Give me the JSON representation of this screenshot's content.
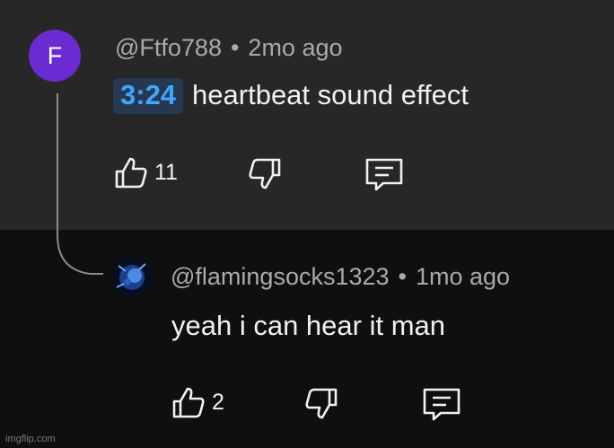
{
  "comment": {
    "avatar_letter": "F",
    "avatar_color": "#6a2bd0",
    "author": "@Ftfo788",
    "separator": "•",
    "age": "2mo ago",
    "timestamp_link": "3:24",
    "text": "heartbeat sound effect",
    "likes": "11",
    "icons": [
      "thumbs-up-icon",
      "thumbs-down-icon",
      "reply-icon"
    ]
  },
  "reply": {
    "author": "@flamingsocks1323",
    "separator": "•",
    "age": "1mo ago",
    "text": "yeah i can hear it man",
    "likes": "2",
    "icons": [
      "thumbs-up-icon",
      "thumbs-down-icon",
      "reply-icon"
    ]
  },
  "colors": {
    "top_bg": "#272727",
    "bottom_bg": "#0f0f0f",
    "meta_text": "#aaaaaa",
    "body_text": "#f1f1f1",
    "timestamp_text": "#3ea6ff",
    "timestamp_bg": "#263850"
  },
  "watermark": "imgflip.com"
}
